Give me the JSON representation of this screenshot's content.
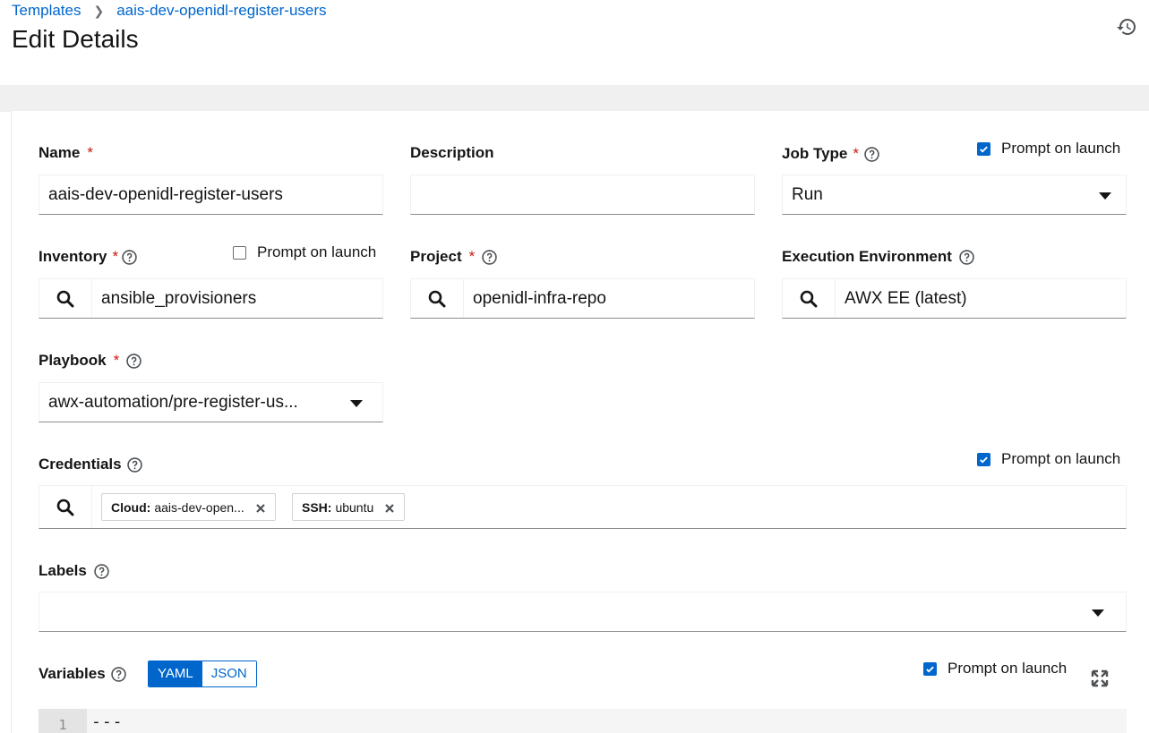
{
  "breadcrumb": {
    "parent": "Templates",
    "current": "aais-dev-openidl-register-users"
  },
  "page_title": "Edit Details",
  "icons": {
    "history": "history-icon",
    "search": "search-icon",
    "help": "question-circle-icon",
    "close": "close-icon",
    "expand": "expand-icon",
    "caret": "caret-down-icon",
    "check": "check-icon"
  },
  "colors": {
    "link": "#0066cc",
    "required": "#c9190b",
    "checkbox": "#0066cc"
  },
  "form": {
    "required_mark": "*",
    "prompt_label": "Prompt on launch",
    "name": {
      "label": "Name",
      "value": "aais-dev-openidl-register-users"
    },
    "description": {
      "label": "Description",
      "value": ""
    },
    "job_type": {
      "label": "Job Type",
      "value": "Run",
      "prompt_checked": true
    },
    "inventory": {
      "label": "Inventory",
      "value": "ansible_provisioners",
      "prompt_checked": false
    },
    "project": {
      "label": "Project",
      "value": "openidl-infra-repo"
    },
    "execution_environment": {
      "label": "Execution Environment",
      "value": "AWX EE (latest)"
    },
    "playbook": {
      "label": "Playbook",
      "value": "awx-automation/pre-register-us..."
    },
    "credentials": {
      "label": "Credentials",
      "prompt_checked": true,
      "chips": [
        {
          "type": "Cloud:",
          "name": "aais-dev-open..."
        },
        {
          "type": "SSH:",
          "name": "ubuntu"
        }
      ]
    },
    "labels": {
      "label": "Labels",
      "value": ""
    },
    "variables": {
      "label": "Variables",
      "modes": [
        "YAML",
        "JSON"
      ],
      "active_mode": "YAML",
      "prompt_checked": true,
      "line_number": "1",
      "code": "---"
    }
  }
}
